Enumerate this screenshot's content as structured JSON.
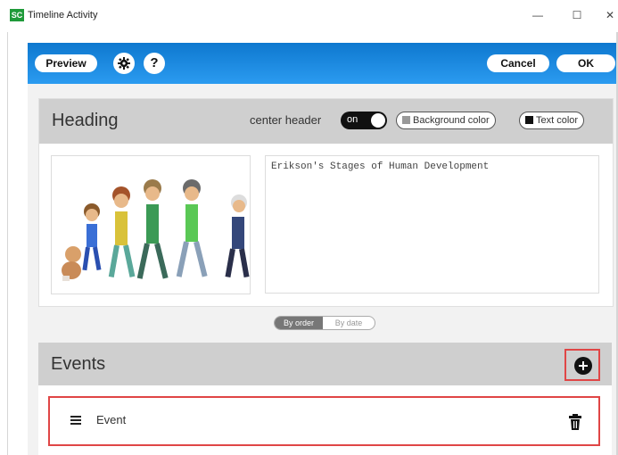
{
  "window": {
    "icon_text": "SC",
    "title": "Timeline Activity",
    "controls": {
      "minimize": "—",
      "maximize": "☐",
      "close": "✕"
    }
  },
  "toolbar": {
    "preview_label": "Preview",
    "settings_icon": "gear-icon",
    "help_label": "?",
    "cancel_label": "Cancel",
    "ok_label": "OK"
  },
  "heading_section": {
    "title": "Heading",
    "center_header_label": "center header",
    "toggle_state": "on",
    "background_color_label": "Background color",
    "text_color_label": "Text color",
    "text_value": "Erikson's Stages of Human Development"
  },
  "sort_options": {
    "by_order": "By order",
    "by_date": "By date",
    "selected": "By order"
  },
  "events_section": {
    "title": "Events",
    "add_icon": "plus-icon",
    "items": [
      {
        "label": "Event"
      }
    ]
  },
  "colors": {
    "toolbar_blue": "#1a87e0",
    "header_gray": "#cfcfcf",
    "highlight_red": "#e04646"
  }
}
